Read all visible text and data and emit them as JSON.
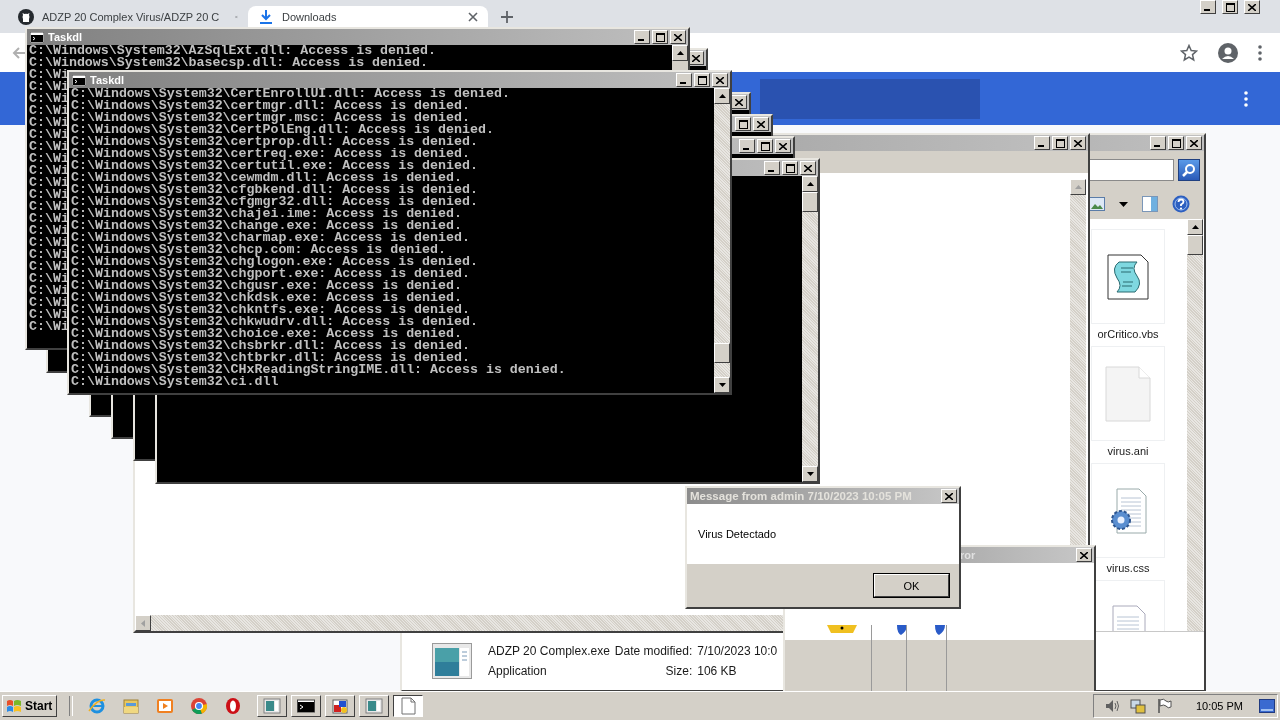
{
  "browser": {
    "tabs": [
      {
        "title": "ADZP 20 Complex Virus/ADZP 20 C",
        "kind": "github",
        "selected": false
      },
      {
        "title": "Downloads",
        "kind": "download",
        "selected": true
      }
    ]
  },
  "consoles": [
    {
      "title": "Taskdl",
      "lines": [
        "C:\\Windows\\System32\\AzSqlExt.dll: Access is denied.",
        "C:\\Windows\\System32\\basecsp.dll: Access is denied.",
        "C:\\Wi",
        "C:\\Wi",
        "C:\\Wi",
        "C:\\Wi",
        "C:\\Wi",
        "C:\\Wi",
        "C:\\Wi",
        "C:\\Wi",
        "C:\\Wi",
        "C:\\Wi",
        "C:\\Wi",
        "C:\\Wi",
        "C:\\Wi",
        "C:\\Wi",
        "C:\\Wi",
        "C:\\Wi",
        "C:\\Wi",
        "C:\\Wi",
        "C:\\Wi",
        "C:\\Wi",
        "C:\\Wi",
        "C:\\Wi"
      ]
    },
    {
      "title": "Taskdl",
      "lines": [
        "C:\\Windows\\System32\\CertEnrollUI.dll: Access is denied.",
        "C:\\Windows\\System32\\certmgr.dll: Access is denied.",
        "C:\\Windows\\System32\\certmgr.msc: Access is denied.",
        "C:\\Windows\\System32\\CertPolEng.dll: Access is denied.",
        "C:\\Windows\\System32\\certprop.dll: Access is denied.",
        "C:\\Windows\\System32\\certreq.exe: Access is denied.",
        "C:\\Windows\\System32\\certutil.exe: Access is denied.",
        "C:\\Windows\\System32\\cewmdm.dll: Access is denied.",
        "C:\\Windows\\System32\\cfgbkend.dll: Access is denied.",
        "C:\\Windows\\System32\\cfgmgr32.dll: Access is denied.",
        "C:\\Windows\\System32\\chajei.ime: Access is denied.",
        "C:\\Windows\\System32\\change.exe: Access is denied.",
        "C:\\Windows\\System32\\charmap.exe: Access is denied.",
        "C:\\Windows\\System32\\chcp.com: Access is denied.",
        "C:\\Windows\\System32\\chglogon.exe: Access is denied.",
        "C:\\Windows\\System32\\chgport.exe: Access is denied.",
        "C:\\Windows\\System32\\chgusr.exe: Access is denied.",
        "C:\\Windows\\System32\\chkdsk.exe: Access is denied.",
        "C:\\Windows\\System32\\chkntfs.exe: Access is denied.",
        "C:\\Windows\\System32\\chkwudrv.dll: Access is denied.",
        "C:\\Windows\\System32\\choice.exe: Access is denied.",
        "C:\\Windows\\System32\\chsbrkr.dll: Access is denied.",
        "C:\\Windows\\System32\\chtbrkr.dll: Access is denied.",
        "C:\\Windows\\System32\\CHxReadingStringIME.dll: Access is denied.",
        "C:\\Windows\\System32\\ci.dll"
      ]
    }
  ],
  "explorer": {
    "files": [
      {
        "name": "orCritico.vbs",
        "kind": "script"
      },
      {
        "name": "virus.ani",
        "kind": "blank"
      },
      {
        "name": "virus.css",
        "kind": "settings"
      },
      {
        "kind": "document"
      }
    ],
    "details": {
      "name": "ADZP 20 Complex.exe",
      "date_label": "Date modified:",
      "date": "7/10/2023 10:0",
      "type": "Application",
      "size_label": "Size:",
      "size": "106 KB"
    }
  },
  "error_dialog": {
    "title": "ror"
  },
  "message_box": {
    "title": "Message from admin 7/10/2023 10:05 PM",
    "text": "Virus Detectado",
    "button": "OK"
  },
  "taskbar": {
    "start": "Start",
    "quick_launch": [
      {
        "kind": "ie"
      },
      {
        "kind": "folder"
      },
      {
        "kind": "media"
      },
      {
        "kind": "chrome"
      },
      {
        "kind": "opera"
      }
    ],
    "tasks": [
      {
        "kind": "window",
        "selected": false
      },
      {
        "kind": "cmd",
        "selected": false
      },
      {
        "kind": "paint",
        "selected": false
      },
      {
        "kind": "window",
        "selected": false
      },
      {
        "kind": "page",
        "selected": true
      }
    ],
    "clock": "10:05 PM"
  }
}
